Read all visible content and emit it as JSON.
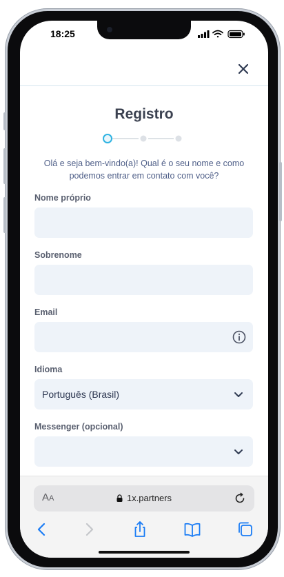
{
  "status_bar": {
    "time": "18:25"
  },
  "form": {
    "title": "Registro",
    "intro": "Olá e seja bem-vindo(a)! Qual é o seu nome e como podemos entrar em contato com você?",
    "fields": [
      {
        "label": "Nome próprio",
        "value": ""
      },
      {
        "label": "Sobrenome",
        "value": ""
      },
      {
        "label": "Email",
        "value": ""
      },
      {
        "label": "Idioma",
        "value": "Português (Brasil)"
      },
      {
        "label": "Messenger (opcional)",
        "value": ""
      }
    ],
    "steps": {
      "current": 1,
      "total": 3
    }
  },
  "browser": {
    "text_size_label_big": "A",
    "text_size_label_small": "A",
    "url": "1x.partners"
  },
  "colors": {
    "accent": "#2fb3e2",
    "title": "#3b4150",
    "field_bg": "#eef3f9"
  },
  "icons": [
    "close-icon",
    "info-icon",
    "chevron-down-icon",
    "lock-icon",
    "reload-icon",
    "back-icon",
    "forward-icon",
    "share-icon",
    "bookmarks-icon",
    "tabs-icon"
  ]
}
